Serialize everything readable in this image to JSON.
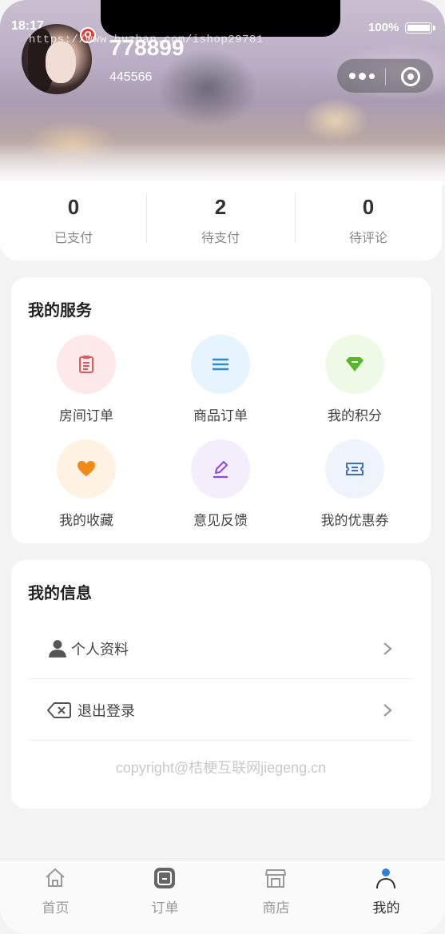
{
  "status_bar": {
    "time": "18:17",
    "battery": "100%"
  },
  "watermark": "https://www.huzhan.com/ishop29781",
  "profile": {
    "username": "778899",
    "user_id": "445566",
    "badge": "Q"
  },
  "stats": [
    {
      "value": "0",
      "label": "已支付"
    },
    {
      "value": "2",
      "label": "待支付"
    },
    {
      "value": "0",
      "label": "待评论"
    }
  ],
  "services": {
    "title": "我的服务",
    "items": [
      {
        "label": "房间订单",
        "icon": "clipboard-icon",
        "color": "#e05a5a",
        "bg": "#fde9e9"
      },
      {
        "label": "商品订单",
        "icon": "list-icon",
        "color": "#2e8bd6",
        "bg": "#e5f4fd"
      },
      {
        "label": "我的积分",
        "icon": "gem-icon",
        "color": "#58b62a",
        "bg": "#eefae6"
      },
      {
        "label": "我的收藏",
        "icon": "heart-icon",
        "color": "#f28a1a",
        "bg": "#fef3e3"
      },
      {
        "label": "意见反馈",
        "icon": "edit-icon",
        "color": "#8a4bd6",
        "bg": "#f4edfc"
      },
      {
        "label": "我的优惠券",
        "icon": "ticket-icon",
        "color": "#3b6fc4",
        "bg": "#eef3fc"
      }
    ]
  },
  "info": {
    "title": "我的信息",
    "items": [
      {
        "label": "个人资料",
        "icon": "person-icon"
      },
      {
        "label": "退出登录",
        "icon": "backspace-icon"
      }
    ]
  },
  "copyright": "copyright@桔梗互联网jiegeng.cn",
  "tabbar": {
    "items": [
      {
        "label": "首页",
        "icon": "home-icon",
        "active": false
      },
      {
        "label": "订单",
        "icon": "order-icon",
        "active": false
      },
      {
        "label": "商店",
        "icon": "store-icon",
        "active": false
      },
      {
        "label": "我的",
        "icon": "user-icon",
        "active": true
      }
    ]
  }
}
